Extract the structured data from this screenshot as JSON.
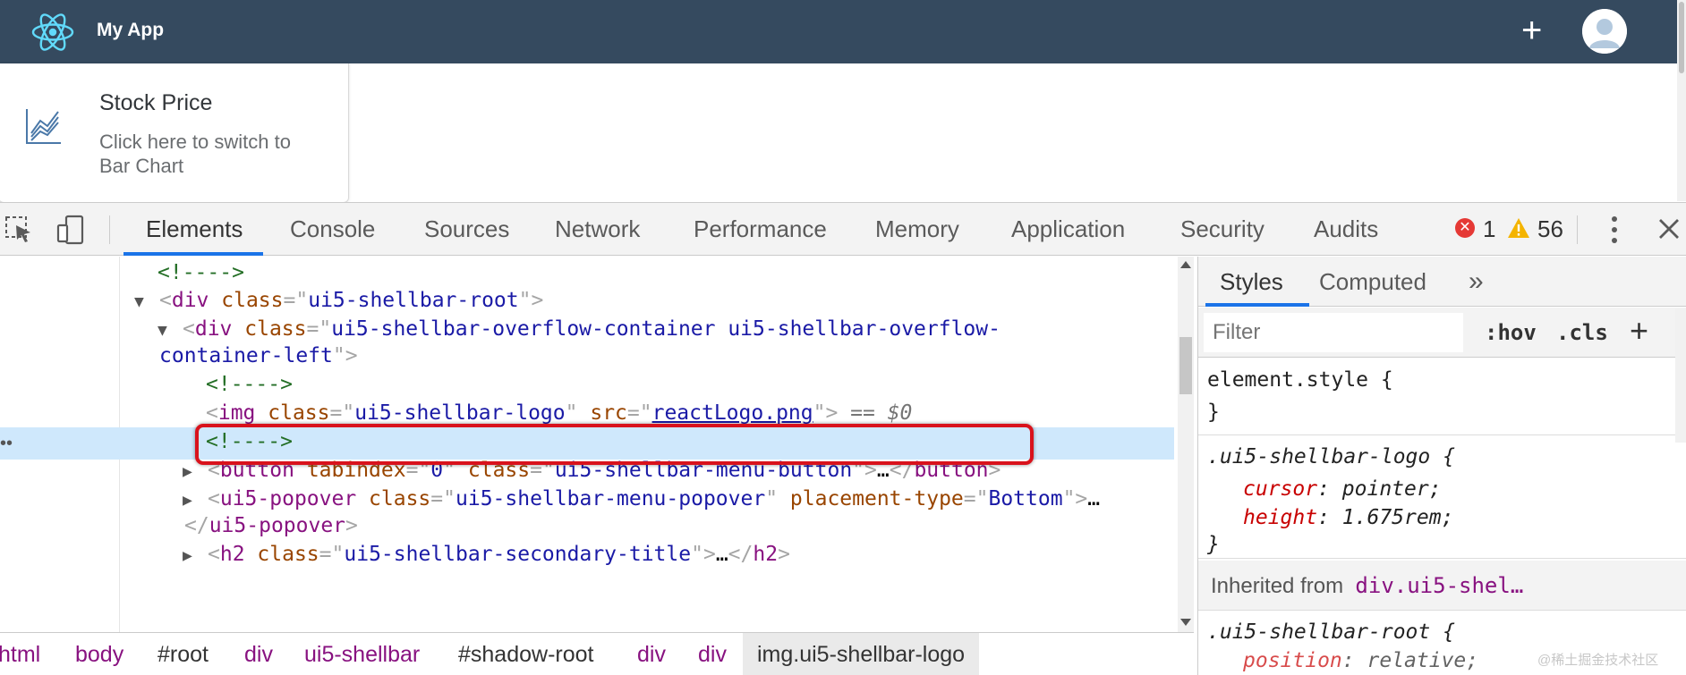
{
  "app": {
    "title": "My App",
    "add_label": "+",
    "card": {
      "title": "Stock Price",
      "subtitle": "Click here to switch to Bar Chart"
    }
  },
  "devtools": {
    "tabs": [
      "Elements",
      "Console",
      "Sources",
      "Network",
      "Performance",
      "Memory",
      "Application",
      "Security",
      "Audits"
    ],
    "active_tab": "Elements",
    "error_count": "1",
    "warning_count": "56",
    "tree": {
      "comment": "<!---->",
      "root_tag": "div",
      "root_attr": "class",
      "root_val": "ui5-shellbar-root",
      "ov_tag": "div",
      "ov_attr": "class",
      "ov_val_1": "ui5-shellbar-overflow-container ui5-shellbar-overflow-",
      "ov_val_2": "container-left",
      "img_tag": "img",
      "img_attr1": "class",
      "img_val1": "ui5-shellbar-logo",
      "img_attr2": "src",
      "img_val2": "reactLogo.png",
      "img_eq": "== $0",
      "btn_tag": "button",
      "btn_attr1": "tabindex",
      "btn_val1": "0",
      "btn_attr2": "class",
      "btn_val2": "ui5-shellbar-menu-button",
      "btn_ellipsis": "…",
      "pop_tag": "ui5-popover",
      "pop_attr1": "class",
      "pop_val1": "ui5-shellbar-menu-popover",
      "pop_attr2": "placement-type",
      "pop_val2": "Bottom",
      "pop_ellipsis": "…",
      "h2_tag": "h2",
      "h2_attr": "class",
      "h2_val": "ui5-shellbar-secondary-title",
      "h2_ellipsis": "…"
    },
    "breadcrumbs": [
      "html",
      "body",
      "#root",
      "div",
      "ui5-shellbar",
      "#shadow-root",
      "div",
      "div",
      "img.ui5-shellbar-logo"
    ],
    "styles": {
      "tabs": [
        "Styles",
        "Computed"
      ],
      "more_tabs": "»",
      "filter_placeholder": "Filter",
      "hov": ":hov",
      "cls": ".cls",
      "add": "+",
      "element_style": "element.style {",
      "close_brace": "}",
      "logo_selector": ".ui5-shellbar-logo {",
      "logo_props": [
        {
          "name": "cursor",
          "value": "pointer;"
        },
        {
          "name": "height",
          "value": "1.675rem;"
        }
      ],
      "inherited_label": "Inherited from",
      "inherited_selector": "div.ui5-shel…",
      "root_selector": ".ui5-shellbar-root {",
      "root_prop": {
        "name": "position",
        "value": "relative;"
      }
    }
  },
  "watermark": "@稀土掘金技术社区",
  "colors": {
    "shellbar": "#354a5f",
    "accent": "#1a73e8",
    "highlight_box": "#d9121c",
    "selected_row": "#cfe8fc"
  }
}
